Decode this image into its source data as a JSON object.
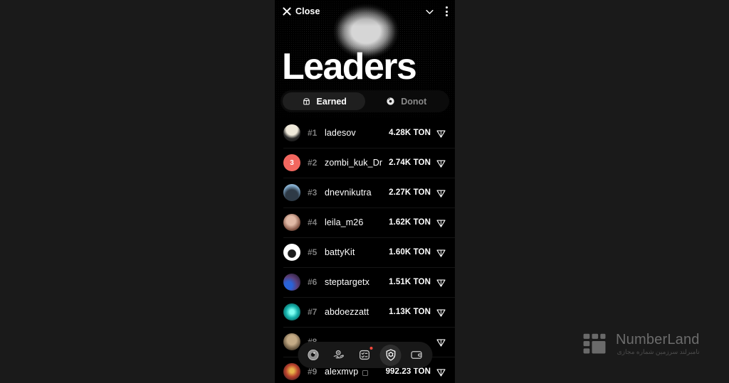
{
  "app": {
    "background_color": "#1a1a1a",
    "screen_background": "#000000",
    "accent_color": "#f2675f"
  },
  "topbar": {
    "close_label": "Close",
    "close_icon": "close-x-icon",
    "chevron_icon": "chevron-down-icon",
    "menu_icon": "kebab-menu-icon"
  },
  "hero": {
    "title": "Leaders"
  },
  "tabs": [
    {
      "label": "Earned",
      "icon": "can-icon",
      "active": true
    },
    {
      "label": "Donot",
      "icon": "donut-icon",
      "active": false
    }
  ],
  "leaderboard": {
    "rows": [
      {
        "rank": "#1",
        "username": "ladesov",
        "amount": "4.28K TON",
        "avatar": "photo",
        "avatar_text": "",
        "avatar_color": "#d9d4c8"
      },
      {
        "rank": "#2",
        "username": "zombi_kuk_Dr",
        "amount": "2.74K TON",
        "avatar": "badge",
        "avatar_text": "3",
        "avatar_color": "#f2675f"
      },
      {
        "rank": "#3",
        "username": "dnevnikutra",
        "amount": "2.27K TON",
        "avatar": "photo",
        "avatar_text": "",
        "avatar_color": "#6f97b8"
      },
      {
        "rank": "#4",
        "username": "leila_m26",
        "amount": "1.62K TON",
        "avatar": "photo",
        "avatar_text": "",
        "avatar_color": "#a9786a"
      },
      {
        "rank": "#5",
        "username": "battyKit",
        "amount": "1.60K TON",
        "avatar": "photo",
        "avatar_text": "",
        "avatar_color": "#f4f4f4"
      },
      {
        "rank": "#6",
        "username": "steptargetx",
        "amount": "1.51K TON",
        "avatar": "photo",
        "avatar_text": "",
        "avatar_color": "#4b3f6e"
      },
      {
        "rank": "#7",
        "username": "abdoezzatt",
        "amount": "1.13K TON",
        "avatar": "photo",
        "avatar_text": "",
        "avatar_color": "#1fc7c0"
      },
      {
        "rank": "#8",
        "username": "",
        "amount": "",
        "avatar": "photo",
        "avatar_text": "",
        "avatar_color": "#8d7a5f"
      },
      {
        "rank": "#9",
        "username": "alexmvp",
        "amount": "992.23 TON",
        "avatar": "photo",
        "avatar_text": "",
        "avatar_color": "#9c4a3a"
      }
    ],
    "currency_icon": "ton-diamond-icon"
  },
  "bottom_nav": {
    "items": [
      {
        "icon": "coin-icon",
        "active": false,
        "badge": false
      },
      {
        "icon": "hand-coin-icon",
        "active": false,
        "badge": false
      },
      {
        "icon": "tasks-icon",
        "active": false,
        "badge": true
      },
      {
        "icon": "badge-gear-icon",
        "active": true,
        "badge": false
      },
      {
        "icon": "wallet-icon",
        "active": false,
        "badge": false
      }
    ]
  },
  "watermark": {
    "title": "NumberLand",
    "subtitle": "نامبرلند سرزمین شماره مجازی",
    "logo_icon": "numberland-logo-icon"
  }
}
